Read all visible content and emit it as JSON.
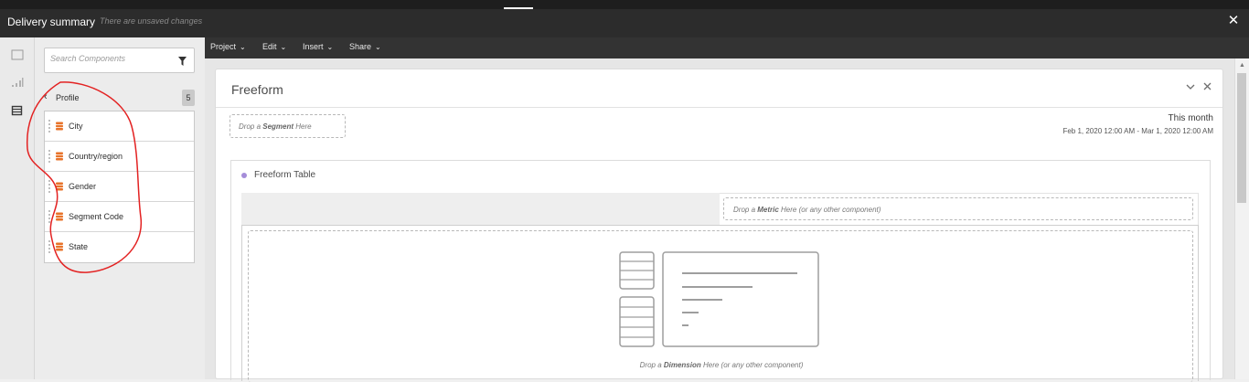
{
  "window": {
    "title": "Delivery summary",
    "unsaved_note": "There are unsaved changes",
    "close_symbol": "✕"
  },
  "left_rail": {
    "icons": [
      "panel-icon",
      "visualization-icon",
      "components-icon"
    ]
  },
  "components_panel": {
    "search_placeholder": "Search Components",
    "filter_icon": "filter-icon",
    "group_label": "Profile",
    "group_count": "5",
    "items": [
      {
        "label": "City"
      },
      {
        "label": "Country/region"
      },
      {
        "label": "Gender"
      },
      {
        "label": "Segment Code"
      },
      {
        "label": "State"
      }
    ],
    "annotation_color": "#e32222"
  },
  "menubar": {
    "menus": [
      {
        "label": "Project"
      },
      {
        "label": "Edit"
      },
      {
        "label": "Insert"
      },
      {
        "label": "Share"
      }
    ]
  },
  "panel": {
    "title": "Freeform",
    "segment_drop_prefix": "Drop a ",
    "segment_drop_bold": "Segment",
    "segment_drop_suffix": " Here",
    "date_label": "This month",
    "date_range": "Feb 1, 2020 12:00 AM - Mar 1, 2020 12:00 AM"
  },
  "table": {
    "title": "Freeform Table",
    "dot_color": "#a58dd9",
    "metric_drop_prefix": "Drop a ",
    "metric_drop_bold": "Metric",
    "metric_drop_suffix": " Here (or any other component)",
    "dimension_drop_prefix": "Drop a ",
    "dimension_drop_bold": "Dimension",
    "dimension_drop_suffix": " Here (or any other component)"
  },
  "colors": {
    "titlebar_bg": "#2c2c2c",
    "menubar_bg": "#333333",
    "dimension_icon": "#e8732a"
  }
}
